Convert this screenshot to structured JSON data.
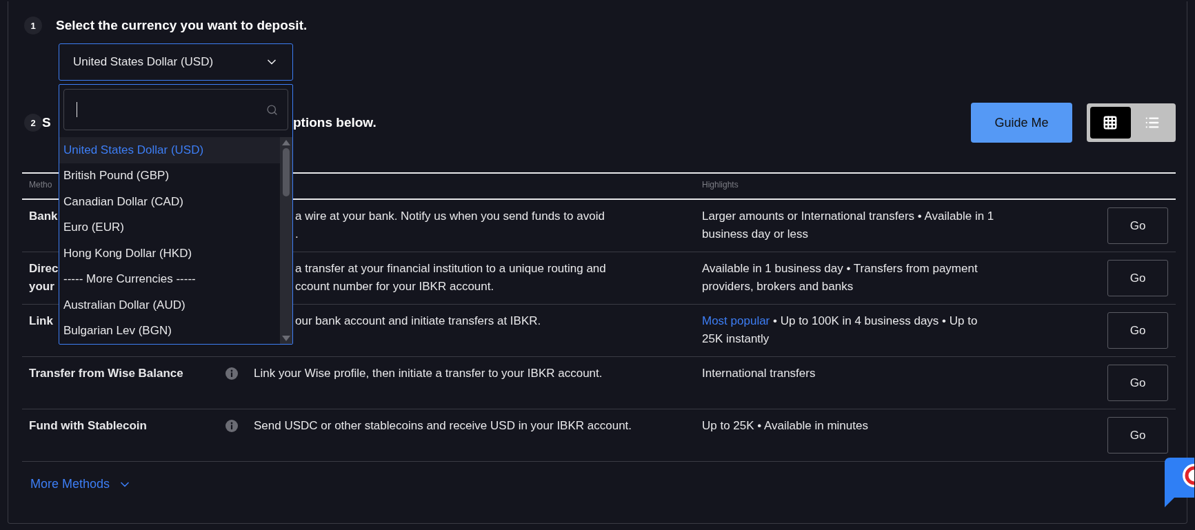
{
  "step1": {
    "number": "1",
    "title": "Select the currency you want to deposit.",
    "select": {
      "value": "United States Dollar (USD)",
      "expanded": true
    },
    "options": [
      {
        "label": "United States Dollar (USD)",
        "selected": true
      },
      {
        "label": "British Pound (GBP)",
        "selected": false
      },
      {
        "label": "Canadian Dollar (CAD)",
        "selected": false
      },
      {
        "label": "Euro (EUR)",
        "selected": false
      },
      {
        "label": "Hong Kong Dollar (HKD)",
        "selected": false
      },
      {
        "label": "----- More Currencies -----",
        "selected": false
      },
      {
        "label": "Australian Dollar (AUD)",
        "selected": false
      },
      {
        "label": "Bulgarian Lev (BGN)",
        "selected": false
      }
    ]
  },
  "step2": {
    "number": "2",
    "title_fragments": [
      "S",
      "ptions below."
    ],
    "guide_button": "Guide Me",
    "view_toggle": [
      {
        "kind": "grid",
        "selected": true
      },
      {
        "kind": "list",
        "selected": false
      }
    ]
  },
  "table": {
    "columns": {
      "method": "Metho",
      "highlights": "Highlights"
    },
    "rows": [
      {
        "method": [
          "Bank"
        ],
        "info": false,
        "covered": true,
        "description": [
          "a wire at your bank. Notify us when you send funds to avoid",
          "."
        ],
        "highlights": "Larger amounts or International transfers • Available in 1 business day or less",
        "button": "Go"
      },
      {
        "method": [
          "Direc",
          "your"
        ],
        "info": false,
        "covered": true,
        "description": [
          "a transfer at your financial institution to a unique routing and",
          "ccount number for your IBKR account."
        ],
        "highlights": "Available in 1 business day • Transfers from payment providers, brokers and banks",
        "button": "Go"
      },
      {
        "method": [
          "Link"
        ],
        "info": false,
        "covered": true,
        "description": [
          "our bank account and initiate transfers at IBKR."
        ],
        "tag": "Most popular",
        "highlights": "• Up to 100K in 4 business days • Up to 25K instantly",
        "button": "Go"
      },
      {
        "method": [
          "Transfer from Wise Balance"
        ],
        "info": true,
        "covered": false,
        "description": [
          "Link your Wise profile, then initiate a transfer to your IBKR account."
        ],
        "highlights": "International transfers",
        "button": "Go"
      },
      {
        "method": [
          "Fund with Stablecoin"
        ],
        "info": true,
        "covered": false,
        "description": [
          "Send USDC or other stablecoins and receive USD in your IBKR account."
        ],
        "highlights": "Up to 25K • Available in minutes",
        "button": "Go"
      }
    ]
  },
  "more_methods": "More Methods"
}
